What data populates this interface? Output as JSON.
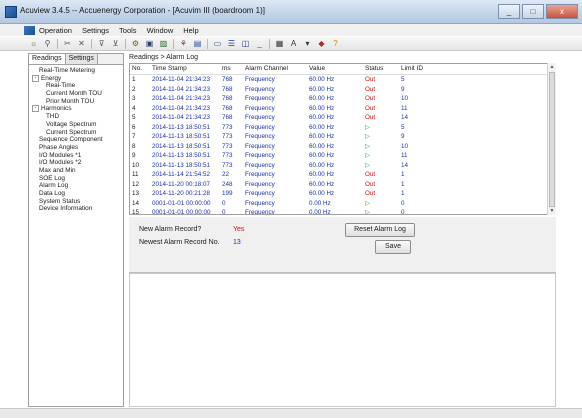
{
  "window": {
    "title": "Acuview 3.4.5 -- Accuenergy Corporation - [Acuvim III (boardroom 1)]",
    "minimize": "_",
    "maximize": "□",
    "close": "x"
  },
  "menu": [
    "Operation",
    "Settings",
    "Tools",
    "Window",
    "Help"
  ],
  "toolbar_icons": [
    "lightbulb-icon",
    "antenna-icon",
    "scissors-icon",
    "cut-icon",
    "funnel-icon",
    "filter-icon",
    "settings-icon",
    "save-icon",
    "image-icon",
    "tree-icon",
    "chart-icon",
    "window-icon",
    "list-icon",
    "split-icon",
    "minus-icon",
    "help-icon",
    "arrow-icon",
    "download-icon",
    "question-icon"
  ],
  "left_pane": {
    "tabs": [
      "Readings",
      "Settings"
    ],
    "tree": [
      {
        "label": "Real-Time Metering",
        "level": 1,
        "expander": ""
      },
      {
        "label": "Energy",
        "level": 0,
        "expander": "-"
      },
      {
        "label": "Real-Time",
        "level": 2,
        "expander": ""
      },
      {
        "label": "Current Month TOU",
        "level": 2,
        "expander": ""
      },
      {
        "label": "Prior Month TOU",
        "level": 2,
        "expander": ""
      },
      {
        "label": "Harmonics",
        "level": 0,
        "expander": "-"
      },
      {
        "label": "THD",
        "level": 2,
        "expander": ""
      },
      {
        "label": "Voltage Spectrum",
        "level": 2,
        "expander": ""
      },
      {
        "label": "Current Spectrum",
        "level": 2,
        "expander": ""
      },
      {
        "label": "Sequence Component",
        "level": 1,
        "expander": ""
      },
      {
        "label": "Phase Angles",
        "level": 1,
        "expander": ""
      },
      {
        "label": "I/O Modules *1",
        "level": 1,
        "expander": ""
      },
      {
        "label": "I/O Modules *2",
        "level": 1,
        "expander": ""
      },
      {
        "label": "Max and Min",
        "level": 1,
        "expander": ""
      },
      {
        "label": "SOE Log",
        "level": 1,
        "expander": ""
      },
      {
        "label": "Alarm Log",
        "level": 1,
        "expander": ""
      },
      {
        "label": "Data Log",
        "level": 1,
        "expander": ""
      },
      {
        "label": "System Status",
        "level": 1,
        "expander": ""
      },
      {
        "label": "Device Information",
        "level": 1,
        "expander": ""
      }
    ]
  },
  "breadcrumb": "Readings > Alarm Log",
  "grid": {
    "columns": [
      "No.",
      "Time Stamp",
      "ms",
      "Alarm Channel",
      "Value",
      "Status",
      "Limit ID"
    ],
    "rows": [
      [
        "1",
        "2014-11-04 21:34:23",
        "768",
        "Frequency",
        "60.00 Hz",
        "Out",
        "5"
      ],
      [
        "2",
        "2014-11-04 21:34:23",
        "768",
        "Frequency",
        "60.00 Hz",
        "Out",
        "9"
      ],
      [
        "3",
        "2014-11-04 21:34:23",
        "768",
        "Frequency",
        "60.00 Hz",
        "Out",
        "10"
      ],
      [
        "4",
        "2014-11-04 21:34:23",
        "768",
        "Frequency",
        "60.00 Hz",
        "Out",
        "11"
      ],
      [
        "5",
        "2014-11-04 21:34:23",
        "768",
        "Frequency",
        "60.00 Hz",
        "Out",
        "14"
      ],
      [
        "6",
        "2014-11-13 18:50:51",
        "773",
        "Frequency",
        "60.00 Hz",
        "In",
        "5"
      ],
      [
        "7",
        "2014-11-13 18:50:51",
        "773",
        "Frequency",
        "60.00 Hz",
        "In",
        "9"
      ],
      [
        "8",
        "2014-11-13 18:50:51",
        "773",
        "Frequency",
        "60.00 Hz",
        "In",
        "10"
      ],
      [
        "9",
        "2014-11-13 18:50:51",
        "773",
        "Frequency",
        "60.00 Hz",
        "In",
        "11"
      ],
      [
        "10",
        "2014-11-13 18:50:51",
        "773",
        "Frequency",
        "60.00 Hz",
        "In",
        "14"
      ],
      [
        "11",
        "2014-11-14 21:54:52",
        "22",
        "Frequency",
        "60.00 Hz",
        "Out",
        "1"
      ],
      [
        "12",
        "2014-11-20 00:18:07",
        "248",
        "Frequency",
        "60.00 Hz",
        "Out",
        "1"
      ],
      [
        "13",
        "2014-11-20 00:21:28",
        "199",
        "Frequency",
        "60.00 Hz",
        "Out",
        "1"
      ],
      [
        "14",
        "0001-01-01 00:00:00",
        "0",
        "Frequency",
        "0.00 Hz",
        "In",
        "0"
      ],
      [
        "15",
        "0001-01-01 00:00:00",
        "0",
        "Frequency",
        "0.00 Hz",
        "In",
        "0"
      ]
    ]
  },
  "alarm_panel": {
    "new_alarm_label": "New Alarm Record?",
    "new_alarm_value": "Yes",
    "newest_label": "Newest Alarm Record No.",
    "newest_value": "13",
    "reset_button": "Reset Alarm Log",
    "save_button": "Save"
  },
  "colors": {
    "data_blue": "#1b2fb0",
    "status_out": "#d01010",
    "status_in": "#22a822",
    "title_gradient": "#c4d5ea"
  }
}
